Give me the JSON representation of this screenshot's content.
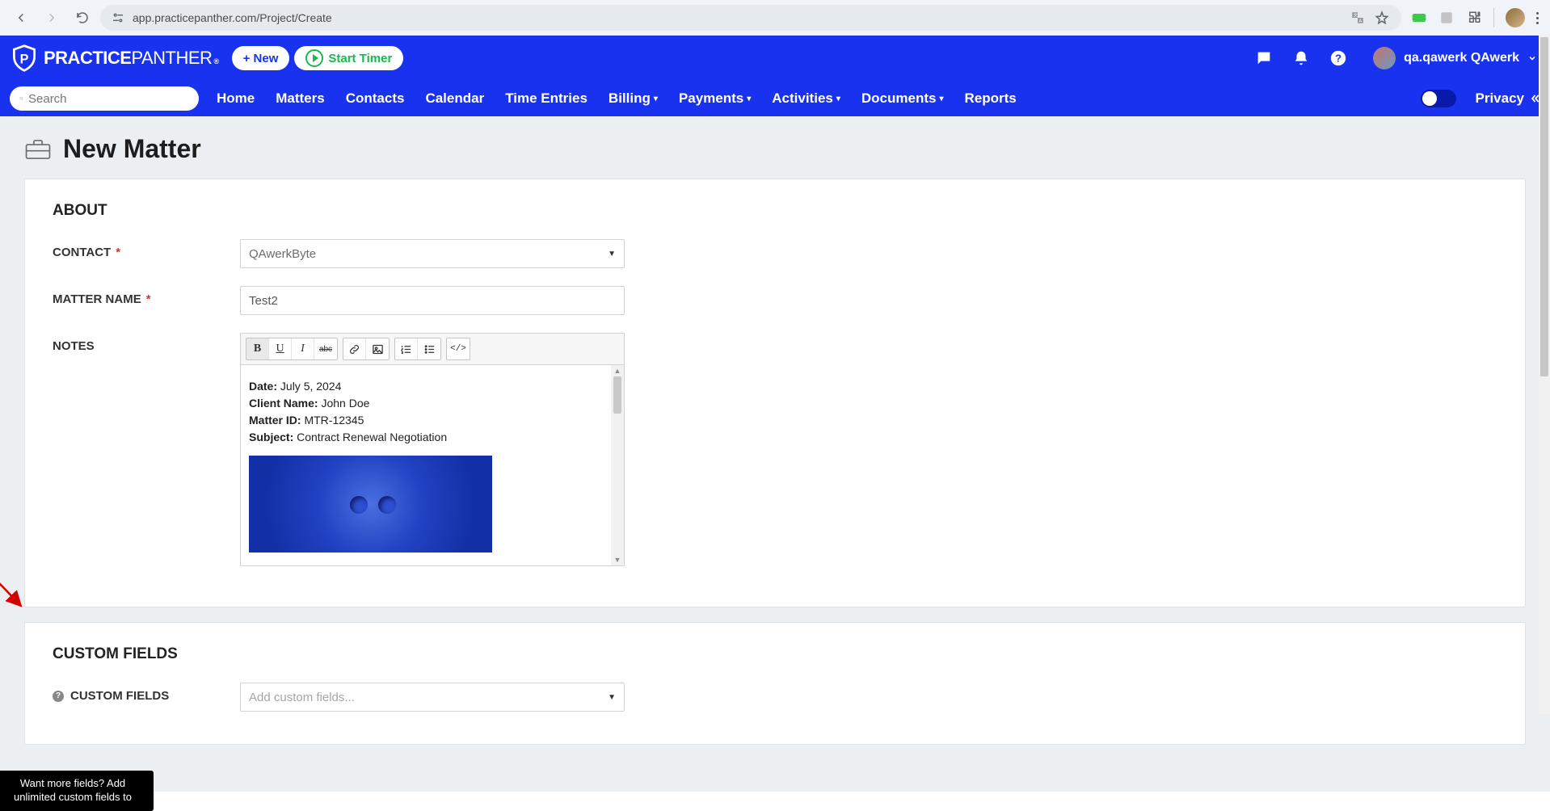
{
  "browser": {
    "url": "app.practicepanther.com/Project/Create"
  },
  "header": {
    "brand_bold": "PRACTICE",
    "brand_light": "PANTHER",
    "tm": "®",
    "new_button": "+ New",
    "timer_button": "Start Timer",
    "user_name": "qa.qawerk QAwerk",
    "search_placeholder": "Search",
    "privacy_label": "Privacy",
    "nav": {
      "home": "Home",
      "matters": "Matters",
      "contacts": "Contacts",
      "calendar": "Calendar",
      "time_entries": "Time Entries",
      "billing": "Billing",
      "payments": "Payments",
      "activities": "Activities",
      "documents": "Documents",
      "reports": "Reports"
    }
  },
  "page": {
    "title": "New Matter",
    "about_heading": "ABOUT",
    "contact_label": "CONTACT",
    "contact_value": "QAwerkByte",
    "matter_name_label": "MATTER NAME",
    "matter_name_value": "Test2",
    "notes_label": "NOTES",
    "notes": {
      "date_lbl": "Date:",
      "date_val": " July 5, 2024",
      "client_lbl": "Client Name:",
      "client_val": " John Doe",
      "matter_lbl": "Matter ID:",
      "matter_val": " MTR-12345",
      "subject_lbl": "Subject:",
      "subject_val": " Contract Renewal Negotiation"
    },
    "custom_fields_heading": "CUSTOM FIELDS",
    "custom_fields_label": "CUSTOM FIELDS",
    "custom_fields_placeholder": "Add custom fields...",
    "tooltip_text": "Want more fields? Add unlimited custom fields to"
  },
  "rte_buttons": {
    "bold": "B",
    "underline": "U",
    "italic": "I",
    "strike": "abc",
    "code": "</>"
  }
}
